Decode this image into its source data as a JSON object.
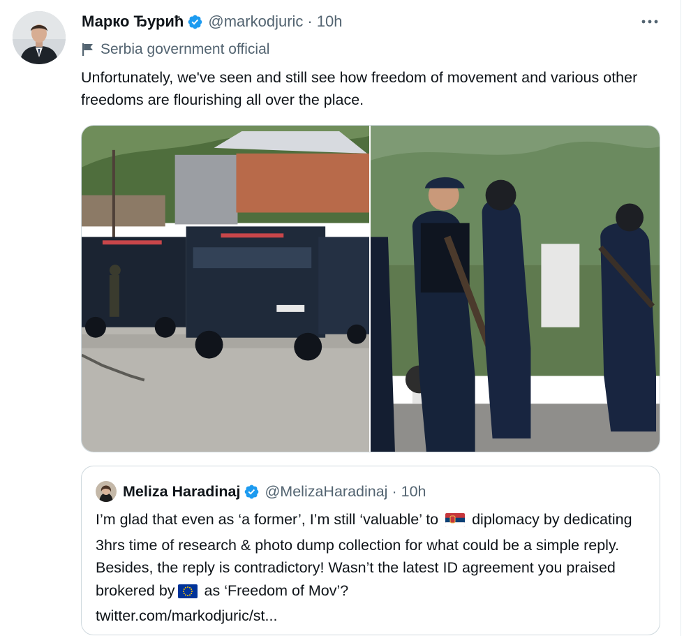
{
  "tweet": {
    "author_name": "Марко Ђурић",
    "handle": "@markodjuric",
    "separator": "·",
    "time": "10h",
    "label": "Serbia government official",
    "text": "Unfortunately, we've seen and still see how freedom of movement and various other freedoms are flourishing all over the place.",
    "media": [
      {
        "description": "armored-vehicles-street-photo"
      },
      {
        "description": "armed-police-officers-photo"
      }
    ]
  },
  "quote": {
    "author_name": "Meliza Haradinaj",
    "handle": "@MelizaHaradinaj",
    "separator": "·",
    "time": "10h",
    "text_1": "I’m glad that even as ‘a former’, I’m still ‘valuable’ to",
    "text_2": "diplomacy by dedicating 3hrs time of research & photo dump collection for what could be a simple reply. Besides, the reply is contradictory! Wasn’t the latest ID agreement you praised brokered by",
    "text_3": "as ‘Freedom of Mov’?",
    "link": "twitter.com/markodjuric/st..."
  },
  "icons": {
    "verified": "verified-badge-icon",
    "more": "more-dots-icon",
    "label": "flag-icon",
    "emoji_1": "serbia-flag-emoji",
    "emoji_2": "eu-flag-emoji"
  },
  "colors": {
    "verified": "#1d9bf0",
    "secondary_text": "#536471",
    "primary_text": "#0f1419",
    "border": "#cfd9de"
  }
}
